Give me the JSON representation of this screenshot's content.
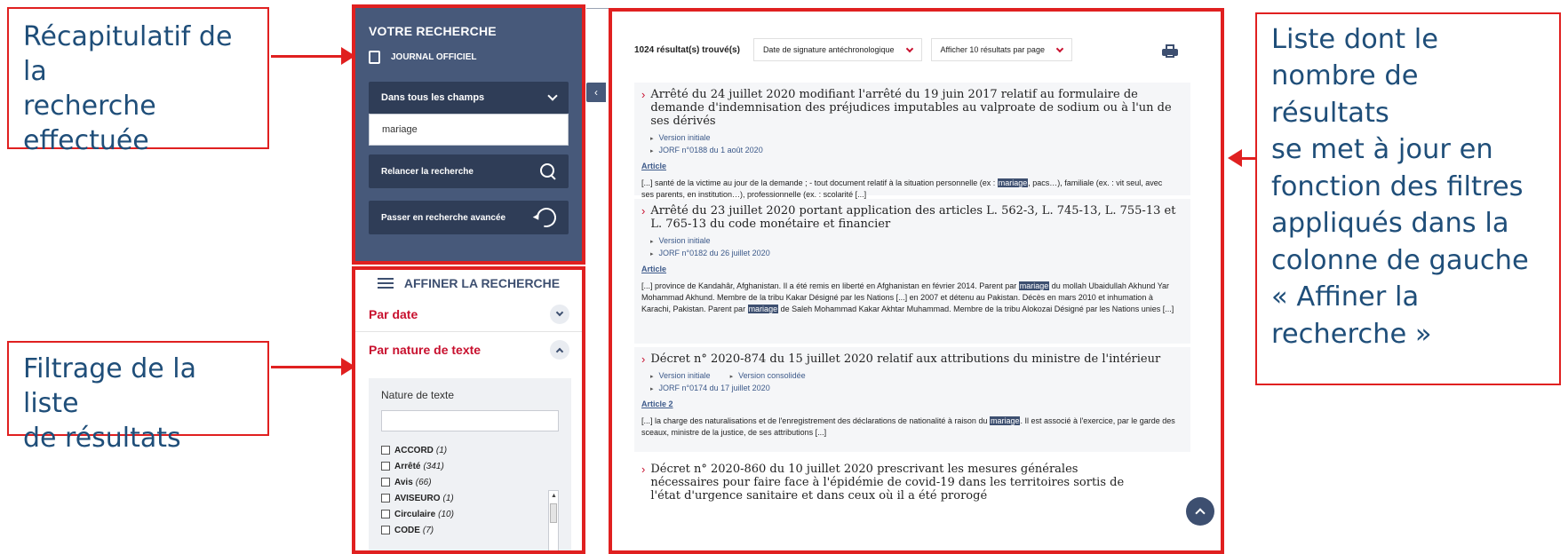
{
  "annotations": {
    "summary_note": "Récapitulatif de la\nrecherche\neffectuée",
    "filter_note": "Filtrage de la liste\nde résultats",
    "results_note": "Liste dont le\nnombre de résultats\nse met à jour en\nfonction des filtres\nappliqués dans la\ncolonne de gauche\n« Affiner la\nrecherche »"
  },
  "summary": {
    "title": "VOTRE RECHERCHE",
    "source": "JOURNAL OFFICIEL",
    "field_select": "Dans tous les champs",
    "query_value": "mariage",
    "relaunch_label": "Relancer la recherche",
    "advanced_label": "Passer en recherche avancée"
  },
  "collapse_tab": "‹",
  "refine": {
    "title": "AFFINER LA RECHERCHE",
    "by_date": "Par date",
    "by_nature": "Par nature de texte",
    "nature_label": "Nature de texte",
    "items": [
      {
        "label": "ACCORD",
        "count": "(1)"
      },
      {
        "label": "Arrêté",
        "count": "(341)"
      },
      {
        "label": "Avis",
        "count": "(66)"
      },
      {
        "label": "AVISEURO",
        "count": "(1)"
      },
      {
        "label": "Circulaire",
        "count": "(10)"
      },
      {
        "label": "CODE",
        "count": "(7)"
      }
    ]
  },
  "results": {
    "count": "1024 résultat(s) trouvé(s)",
    "sort": "Date de signature antéchronologique",
    "per_page": "Afficher 10 résultats par page",
    "items": [
      {
        "title": "Arrêté du 24 juillet 2020 modifiant l'arrêté du 19 juin 2017 relatif au formulaire de demande d'indemnisation des préjudices imputables au valproate de sodium ou à l'un de ses dérivés",
        "meta1": "Version initiale",
        "meta2": "JORF n°0188 du 1 août 2020",
        "article": "Article",
        "s1": "[...] santé de la victime au jour de la demande ; - tout document relatif à la situation personnelle (ex : ",
        "h1": "mariage",
        "s2": ", pacs…), familiale (ex. : vit seul, avec ses parents, en institution…), professionnelle (ex. : scolarité [...]"
      },
      {
        "title": "Arrêté du 23 juillet 2020 portant application des articles L. 562-3, L. 745-13, L. 755-13 et L. 765-13 du code monétaire et financier",
        "meta1": "Version initiale",
        "meta2": "JORF n°0182 du 26 juillet 2020",
        "article": "Article",
        "s1": "[...] province de Kandahâr, Afghanistan. Il a été remis en liberté en Afghanistan en février 2014. Parent par ",
        "h1": "mariage",
        "s2": " du mollah Ubaidullah Akhund Yar Mohammad Akhund. Membre de la tribu Kakar Désigné par les Nations [...] en 2007 et détenu au Pakistan. Décès en mars 2010 et inhumation à Karachi, Pakistan. Parent par ",
        "h2": "mariage",
        "s3": " de Saleh Mohammad Kakar Akhtar Muhammad. Membre de la tribu Alokozai Désigné par les Nations unies [...]"
      },
      {
        "title": "Décret n° 2020-874 du 15 juillet 2020 relatif aux attributions du ministre de l'intérieur",
        "meta1": "Version initiale",
        "meta1b": "Version consolidée",
        "meta2": "JORF n°0174 du 17 juillet 2020",
        "article": "Article 2",
        "s1": "[...] la charge des naturalisations et de l'enregistrement des déclarations de nationalité à raison du ",
        "h1": "mariage",
        "s2": ". Il est associé à l'exercice, par le garde des sceaux, ministre de la justice, de ses attributions [...]"
      },
      {
        "title": "Décret n° 2020-860 du 10 juillet 2020 prescrivant les mesures générales nécessaires pour faire face à l'épidémie de covid-19 dans les territoires sortis de l'état d'urgence sanitaire et dans ceux où il a été prorogé"
      }
    ]
  },
  "colors": {
    "accent_red": "#e02020",
    "panel_navy": "#47597a",
    "filter_red": "#c8102e"
  },
  "icons": [
    "arrow-right-icon",
    "document-icon",
    "chevron-down-icon",
    "search-icon",
    "reset-icon",
    "sliders-icon",
    "print-icon",
    "chevron-up-icon"
  ]
}
